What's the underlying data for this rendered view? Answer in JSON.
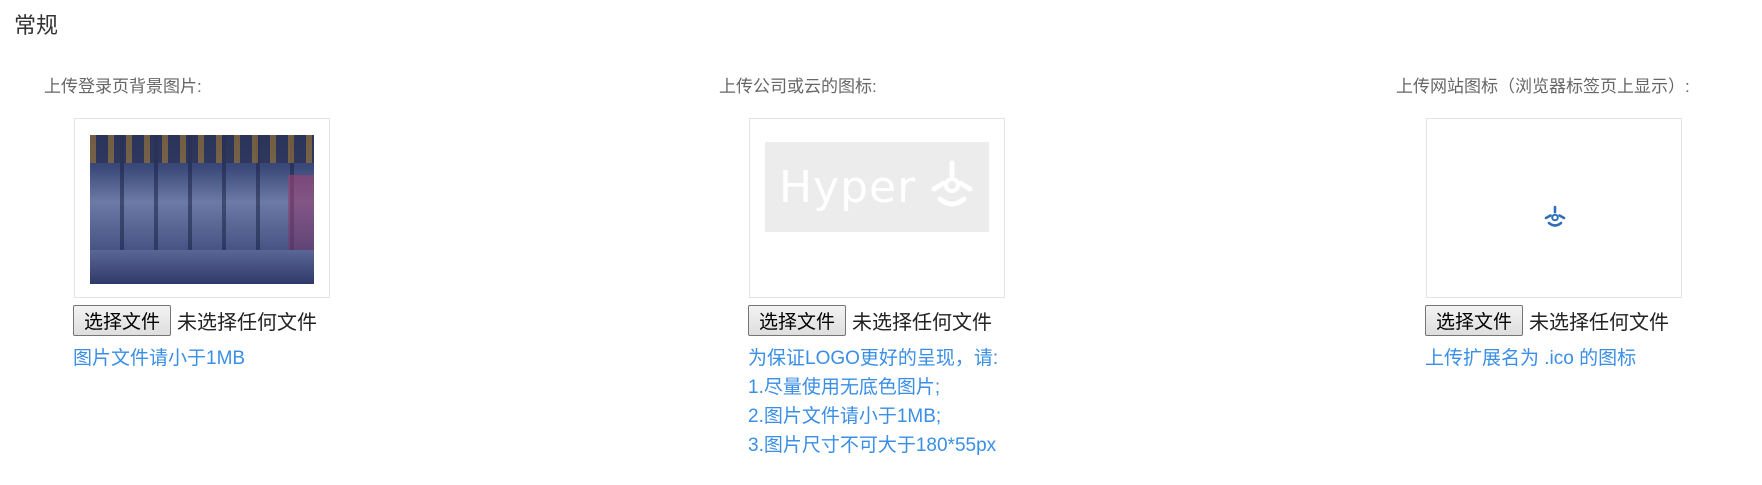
{
  "section": {
    "title": "常规"
  },
  "columns": [
    {
      "label": "上传登录页背景图片:",
      "file_button": "选择文件",
      "file_status": "未选择任何文件",
      "hints": [
        "图片文件请小于1MB"
      ]
    },
    {
      "label": "上传公司或云的图标:",
      "logo_text": "Hyper",
      "file_button": "选择文件",
      "file_status": "未选择任何文件",
      "hints": [
        "为保证LOGO更好的呈现，请:",
        "1.尽量使用无底色图片;",
        "2.图片文件请小于1MB;",
        "3.图片尺寸不可大于180*55px"
      ]
    },
    {
      "label": "上传网站图标（浏览器标签页上显示）:",
      "file_button": "选择文件",
      "file_status": "未选择任何文件",
      "hints": [
        "上传扩展名为 .ico 的图标"
      ]
    }
  ],
  "colors": {
    "hint": "#3a8ee6",
    "favicon": "#2f6fb5"
  },
  "icons": [
    "logo-mark-icon",
    "favicon-icon"
  ]
}
